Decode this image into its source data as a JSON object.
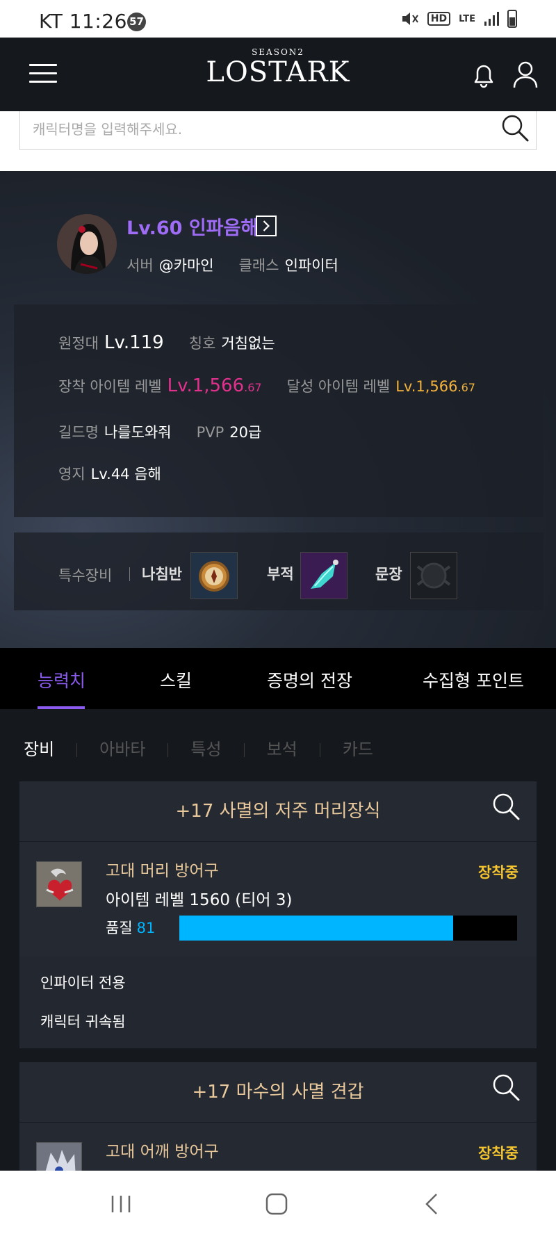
{
  "status_bar": {
    "carrier_time": "KT 11:26",
    "notification_count": "57",
    "hd_label": "HD",
    "lte_label": "LTE"
  },
  "header": {
    "logo_season": "SEASON2",
    "logo_name": "LOSTARK"
  },
  "search": {
    "placeholder": "캐릭터명을 입력해주세요."
  },
  "profile": {
    "character_name": "Lv.60 인파음해",
    "server_label": "서버",
    "server_value": "@카마인",
    "class_label": "클래스",
    "class_value": "인파이터"
  },
  "stats": {
    "expedition_label": "원정대",
    "expedition_value": "Lv.119",
    "title_label": "칭호",
    "title_value": "거침없는",
    "equip_level_label": "장착 아이템 레벨",
    "equip_level_main": "Lv.1,566",
    "equip_level_decimal": ".67",
    "achieved_level_label": "달성 아이템 레벨",
    "achieved_level_main": "Lv.1,566",
    "achieved_level_decimal": ".67",
    "guild_label": "길드명",
    "guild_value": "나를도와줘",
    "pvp_label": "PVP",
    "pvp_value": "20급",
    "estate_label": "영지",
    "estate_value": "Lv.44 음해"
  },
  "special_equipment": {
    "label": "특수장비",
    "items": [
      {
        "name": "나침반",
        "icon": "compass-icon"
      },
      {
        "name": "부적",
        "icon": "amulet-icon"
      },
      {
        "name": "문장",
        "icon": "emblem-icon"
      }
    ]
  },
  "tabs": [
    {
      "label": "능력치",
      "active": true
    },
    {
      "label": "스킬",
      "active": false
    },
    {
      "label": "증명의 전장",
      "active": false
    },
    {
      "label": "수집형 포인트",
      "active": false
    }
  ],
  "subtabs": [
    {
      "label": "장비",
      "active": true
    },
    {
      "label": "아바타",
      "active": false
    },
    {
      "label": "특성",
      "active": false
    },
    {
      "label": "보석",
      "active": false
    },
    {
      "label": "카드",
      "active": false
    }
  ],
  "items": [
    {
      "title": "+17 사멸의 저주 머리장식",
      "type": "고대 머리 방어구",
      "level": "아이템 레벨 1560 (티어 3)",
      "quality_label": "품질",
      "quality_value": "81",
      "quality_fraction": 0.81,
      "status": "장착중",
      "notes": [
        "인파이터 전용",
        "캐릭터 귀속됨"
      ]
    },
    {
      "title": "+17 마수의 사멸 견갑",
      "type": "고대 어깨 방어구",
      "status": "장착중"
    }
  ],
  "colors": {
    "accent_purple": "#8c5bf0",
    "equip_level_pink": "#e2318d",
    "achieved_level_gold": "#f3b23c",
    "quality_blue": "#00b5ff",
    "equipped_yellow": "#f5c530",
    "item_title": "#e9c99b"
  }
}
